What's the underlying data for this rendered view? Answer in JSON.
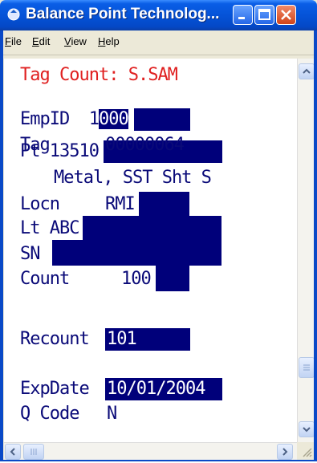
{
  "window": {
    "title": "Balance Point Technolog...",
    "icons": [
      "app-icon",
      "minimize-icon",
      "maximize-icon",
      "close-icon"
    ]
  },
  "menu": {
    "items": [
      {
        "label": "File",
        "mnemonic": "F",
        "rest": "ile"
      },
      {
        "label": "Edit",
        "mnemonic": "E",
        "rest": "dit"
      },
      {
        "label": "View",
        "mnemonic": "V",
        "rest": "iew"
      },
      {
        "label": "Help",
        "mnemonic": "H",
        "rest": "elp"
      }
    ]
  },
  "screen": {
    "header_label": "Tag Count: ",
    "header_user": "S.SAM",
    "empid_label": "EmpID",
    "empid_value_plain": "1",
    "empid_value_highlight": "000",
    "tag_label": "Tag",
    "tag_value": "00000064",
    "pt_label": "Pt ",
    "pt_value": "13510",
    "description": "Metal, SST Sht S",
    "locn_label": "Locn",
    "locn_value": "RMI",
    "lt_label": "Lt ",
    "lt_value": "ABC",
    "sn_label": "SN",
    "count_label": "Count",
    "count_value": "100",
    "recount_label": "Recount",
    "recount_value": "101",
    "expdate_label": "ExpDate",
    "expdate_value": "10/01/2004",
    "qcode_label": "Q Code",
    "qcode_value": "N"
  },
  "colors": {
    "text": "#0a0a78",
    "header_text": "#e02020",
    "highlight": "#00007a",
    "titlebar": "#0553d8"
  }
}
